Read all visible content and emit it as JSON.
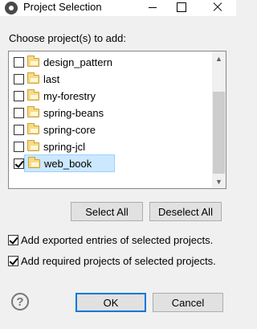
{
  "window": {
    "title": "Project Selection"
  },
  "instruction": "Choose project(s) to add:",
  "projects": [
    {
      "name": "design_pattern",
      "checked": false,
      "selected": false
    },
    {
      "name": "last",
      "checked": false,
      "selected": false
    },
    {
      "name": "my-forestry",
      "checked": false,
      "selected": false
    },
    {
      "name": "spring-beans",
      "checked": false,
      "selected": false
    },
    {
      "name": "spring-core",
      "checked": false,
      "selected": false
    },
    {
      "name": "spring-jcl",
      "checked": false,
      "selected": false
    },
    {
      "name": "web_book",
      "checked": true,
      "selected": true
    }
  ],
  "buttons": {
    "select_all": "Select All",
    "deselect_all": "Deselect All",
    "ok": "OK",
    "cancel": "Cancel"
  },
  "options": {
    "exported": {
      "label": "Add exported entries of selected projects.",
      "checked": true
    },
    "required": {
      "label": "Add required projects of selected projects.",
      "checked": true
    }
  },
  "colors": {
    "selection_bg": "#cce8ff",
    "default_button_border": "#0078d7"
  }
}
